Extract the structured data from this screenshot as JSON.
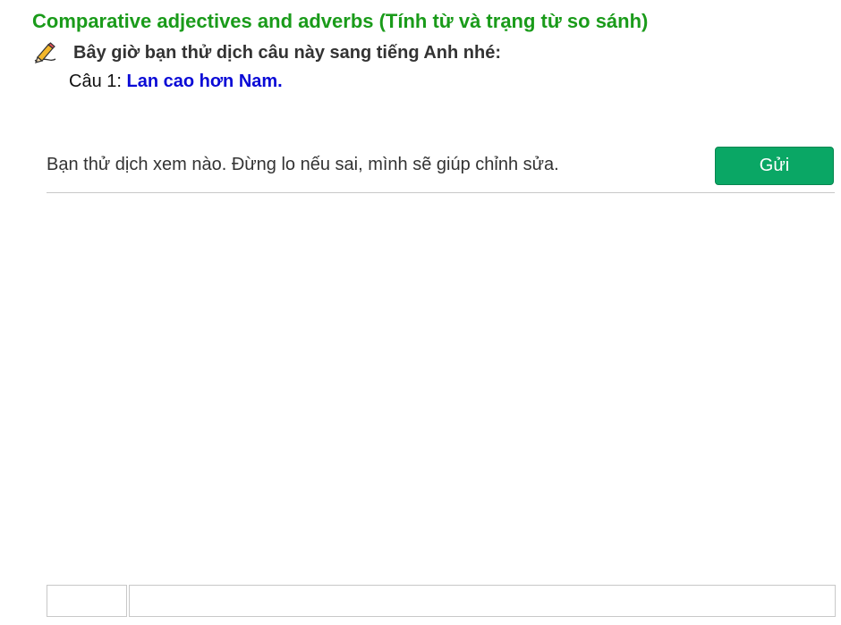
{
  "lesson": {
    "title": "Comparative adjectives and adverbs (Tính từ và trạng từ so sánh)",
    "instruction": "Bây giờ bạn thử dịch câu này sang tiếng Anh nhé:",
    "instruction_icon": "pencil-writing-icon",
    "question_label": "Câu 1: ",
    "question_text": "Lan cao hơn Nam."
  },
  "answer": {
    "placeholder": "Bạn thử dịch xem nào. Đừng lo nếu sai, mình sẽ giúp chỉnh sửa.",
    "value": ""
  },
  "actions": {
    "send_label": "Gửi"
  },
  "colors": {
    "title": "#1a9b1a",
    "question_text": "#0a0ad6",
    "send_button": "#0aa765"
  }
}
